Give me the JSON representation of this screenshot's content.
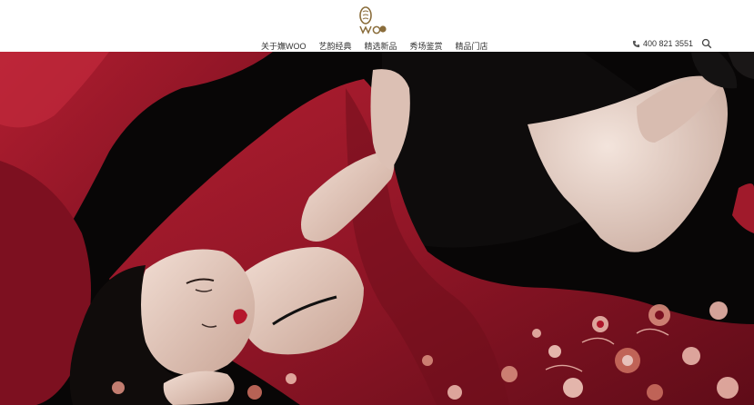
{
  "brand": {
    "logo_name": "woo-logo-icon",
    "colors": {
      "logo_gold": "#8a6d3b",
      "nav_text": "#333333"
    }
  },
  "nav": {
    "items": [
      {
        "label": "关于嫵WOO"
      },
      {
        "label": "艺韵经典"
      },
      {
        "label": "精选新品"
      },
      {
        "label": "秀场鉴赏"
      },
      {
        "label": "精品门店"
      }
    ]
  },
  "contact": {
    "phone": "400 821 3551",
    "phone_icon": "phone-icon",
    "search_icon": "search-icon"
  },
  "hero": {
    "colors": {
      "background": "#080606",
      "silk_red": "#a11a2b",
      "silk_dark": "#6f0f1c",
      "skin": "#e7cfc4",
      "embroidery": "#e9b5a9"
    }
  }
}
